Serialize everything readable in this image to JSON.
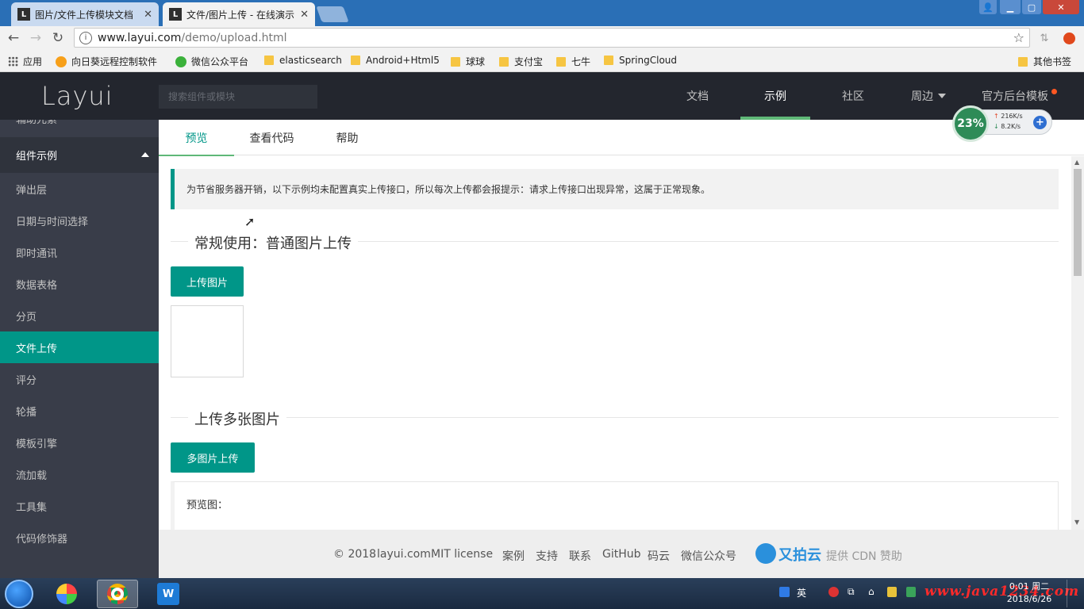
{
  "browser": {
    "tabs": [
      {
        "title": "图片/文件上传模块文档",
        "favicon": "L"
      },
      {
        "title": "文件/图片上传 - 在线演示",
        "favicon": "L"
      }
    ],
    "url_host": "www.layui.com",
    "url_path": "/demo/upload.html",
    "bookmarks": [
      "应用",
      "向日葵远程控制软件",
      "微信公众平台",
      "elasticsearch",
      "Android+Html5",
      "球球",
      "支付宝",
      "七牛",
      "SpringCloud",
      "其他书签"
    ]
  },
  "header": {
    "logo": "Layui",
    "search_placeholder": "搜索组件或模块",
    "nav": [
      "文档",
      "示例",
      "社区",
      "周边",
      "官方后台模板"
    ]
  },
  "net_widget": {
    "percent": "23%",
    "up": "216K/s",
    "down": "8.2K/s"
  },
  "sidebar": {
    "partial_item": "辅助元素",
    "group": "组件示例",
    "items": [
      "弹出层",
      "日期与时间选择",
      "即时通讯",
      "数据表格",
      "分页",
      "文件上传",
      "评分",
      "轮播",
      "模板引擎",
      "流加载",
      "工具集",
      "代码修饰器"
    ]
  },
  "content_tabs": [
    "预览",
    "查看代码",
    "帮助"
  ],
  "content": {
    "notice": "为节省服务器开销，以下示例均未配置真实上传接口，所以每次上传都会报提示：请求上传接口出现异常，这属于正常现象。",
    "section1_title": "常规使用：普通图片上传",
    "upload_btn": "上传图片",
    "section2_title": "上传多张图片",
    "multi_btn": "多图片上传",
    "preview_label": "预览图："
  },
  "footer": {
    "copyright": "© 2018",
    "site": "layui.com",
    "license": "MIT license",
    "links": [
      "案例",
      "支持",
      "联系",
      "GitHub",
      "码云",
      "微信公众号"
    ],
    "sponsor": "又拍云",
    "sponsor_text": "提供 CDN 赞助"
  },
  "taskbar": {
    "ime": "英",
    "time": "0:01 周二",
    "date": "2018/6/26",
    "watermark": "www.java1234.com"
  },
  "colors": {
    "accent": "#009688",
    "header_bg": "#23262e",
    "sidebar_bg": "#393d49",
    "nav_active_bar": "#5fb878"
  }
}
